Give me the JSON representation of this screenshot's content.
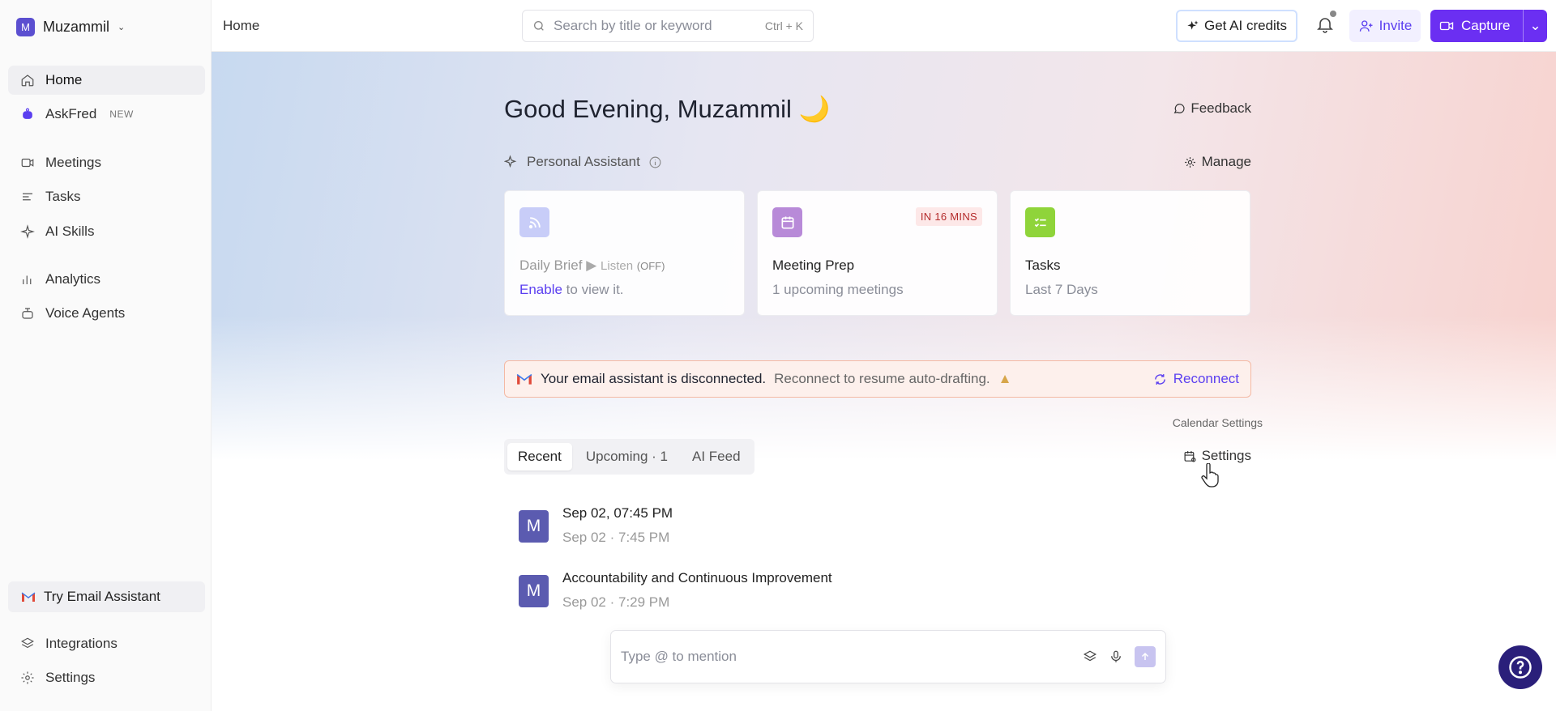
{
  "workspace": {
    "initial": "M",
    "name": "Muzammil"
  },
  "sidebar": {
    "items": [
      {
        "label": "Home",
        "icon": "home-icon"
      },
      {
        "label": "AskFred",
        "badge": "NEW",
        "icon": "bot-icon"
      },
      {
        "label": "Meetings",
        "icon": "video-icon"
      },
      {
        "label": "Tasks",
        "icon": "list-icon"
      },
      {
        "label": "AI Skills",
        "icon": "sparkle-icon"
      },
      {
        "label": "Analytics",
        "icon": "bar-chart-icon"
      },
      {
        "label": "Voice Agents",
        "icon": "robot-icon"
      }
    ],
    "try_email": "Try Email Assistant",
    "bottom": [
      {
        "label": "Integrations",
        "icon": "layers-icon"
      },
      {
        "label": "Settings",
        "icon": "gear-icon"
      }
    ]
  },
  "topbar": {
    "breadcrumb": "Home",
    "search_placeholder": "Search by title or keyword",
    "search_shortcut": "Ctrl + K",
    "credits_label": "Get AI credits",
    "invite_label": "Invite",
    "capture_label": "Capture"
  },
  "main": {
    "greeting": "Good Evening, Muzammil",
    "feedback": "Feedback",
    "assistant_label": "Personal Assistant",
    "manage": "Manage",
    "cards": {
      "brief": {
        "title": "Daily Brief",
        "listen": "Listen",
        "listen_state": "(OFF)",
        "enable": "Enable",
        "sub_rest": "to view it."
      },
      "prep": {
        "title": "Meeting Prep",
        "sub": "1 upcoming meetings",
        "tag": "IN 16 MINS"
      },
      "tasks": {
        "title": "Tasks",
        "sub": "Last 7 Days"
      }
    },
    "banner": {
      "strong": "Your email assistant is disconnected.",
      "rest": "Reconnect to resume auto-drafting.",
      "action": "Reconnect"
    },
    "tooltip": "Calendar Settings",
    "tabs": [
      "Recent",
      "Upcoming · 1",
      "AI Feed"
    ],
    "settings": "Settings",
    "meetings": [
      {
        "avatar": "M",
        "title": "Sep 02, 07:45 PM",
        "sub": "Sep 02 · 7:45 PM"
      },
      {
        "avatar": "M",
        "title": "Accountability and Continuous Improvement",
        "sub": "Sep 02 · 7:29 PM"
      }
    ],
    "chat_placeholder": "Type @ to mention"
  },
  "colors": {
    "accent": "#6b2ff2",
    "banner_border": "#f4b9a4",
    "tag_red": "#b42b2b"
  }
}
